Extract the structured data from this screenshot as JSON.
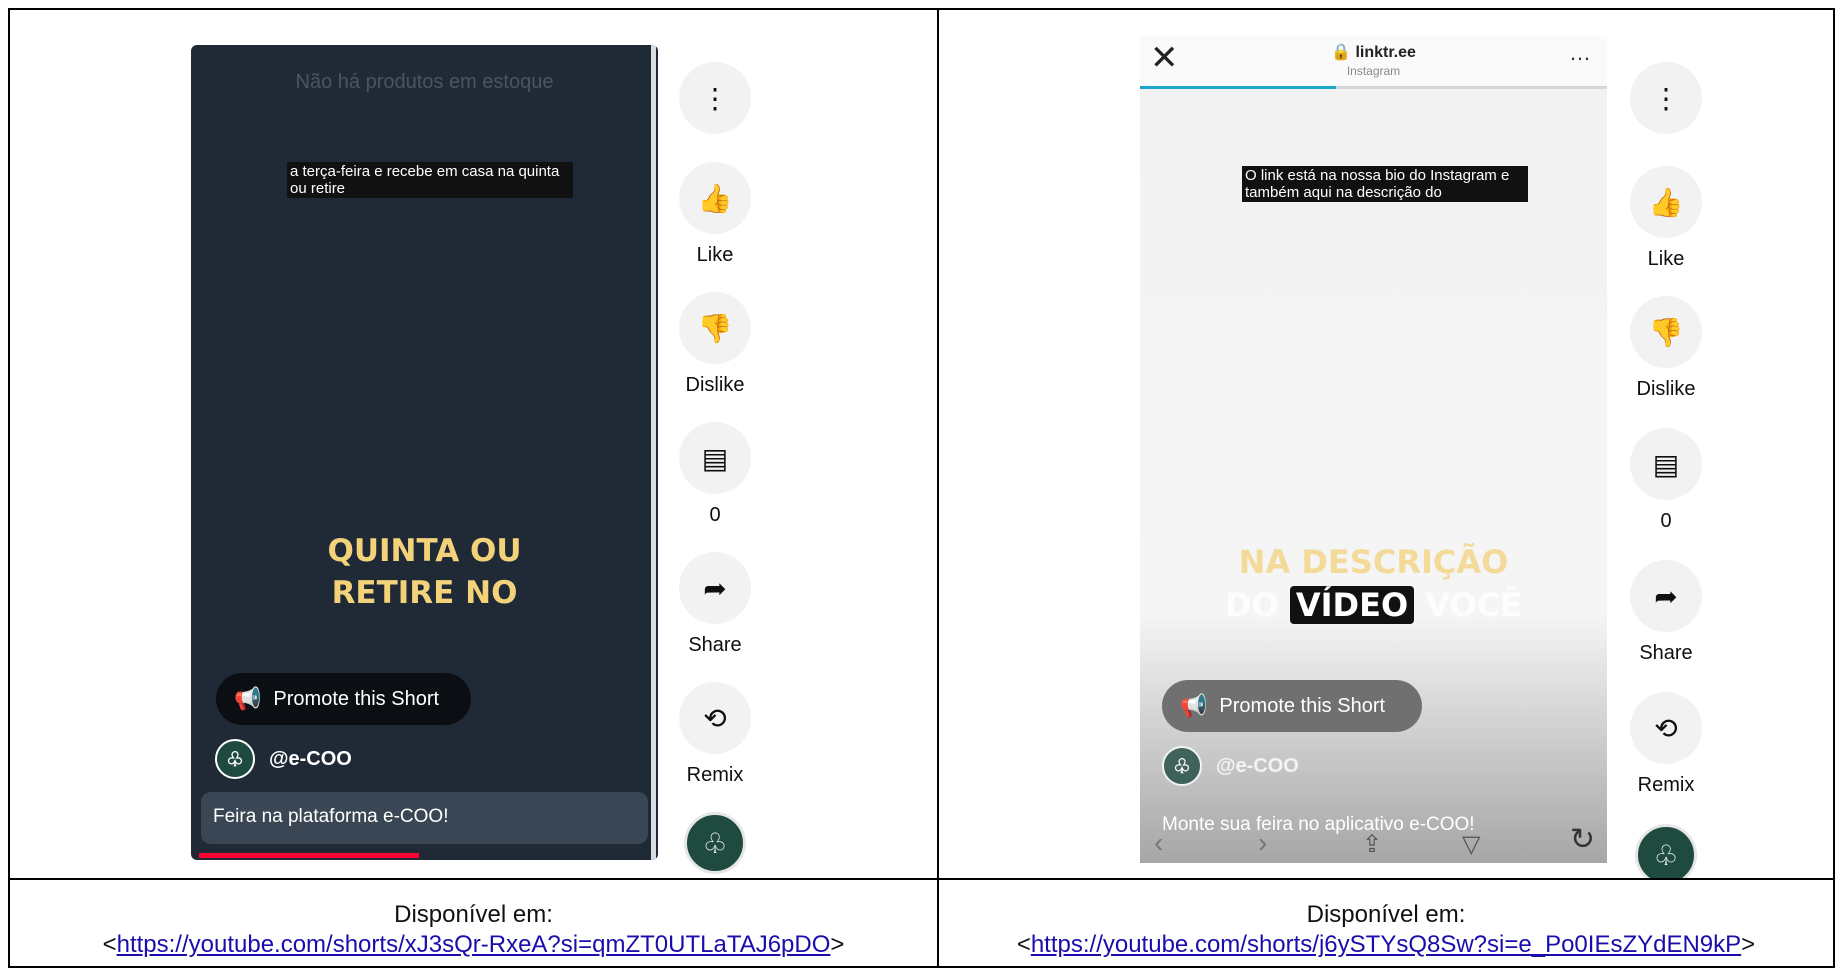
{
  "left": {
    "frame": {
      "top_text": "Não há produtos em estoque",
      "caption": "a terça-feira e recebe em casa na quinta ou retire",
      "big_text_1": "QUINTA OU",
      "big_text_2": "RETIRE NO",
      "promote_label": "Promote this Short",
      "channel": "@e-COO",
      "description": "Feira na plataforma e-COO!"
    },
    "actions": {
      "like_label": "Like",
      "dislike_label": "Dislike",
      "comments_count": "0",
      "share_label": "Share",
      "remix_label": "Remix"
    },
    "caption_label": "Disponível em:",
    "caption_link": "https://youtube.com/shorts/xJ3sQr-RxeA?si=qmZT0UTLaTAJ6pDO",
    "caption_open": "<",
    "caption_close": ">"
  },
  "right": {
    "frame": {
      "browser_title": "linktr.ee",
      "browser_subtitle": "Instagram",
      "caption": "O link está na nossa bio do Instagram e também aqui na descrição do",
      "big_text_1": "NA DESCRIÇÃO",
      "big_text_2a": "DO",
      "big_text_2b": "VÍDEO",
      "big_text_2c": "VOCÊ",
      "promote_label": "Promote this Short",
      "channel": "@e-COO",
      "description": "Monte sua feira no aplicativo e-COO!"
    },
    "actions": {
      "like_label": "Like",
      "dislike_label": "Dislike",
      "comments_count": "0",
      "share_label": "Share",
      "remix_label": "Remix"
    },
    "caption_label": "Disponível em:",
    "caption_link": "https://youtube.com/shorts/j6ySTYsQ8Sw?si=e_Po0IEsZYdEN9kP",
    "caption_open": "<",
    "caption_close": ">"
  },
  "colors": {
    "left_bg": "#1f2a36",
    "yellow_text": "#f3d27a",
    "progress_red": "#ff0033",
    "avatar_green": "#1e4a40"
  },
  "icons": [
    "more-vert-icon",
    "thumb-up-icon",
    "thumb-down-icon",
    "comment-icon",
    "share-icon",
    "remix-icon",
    "megaphone-icon",
    "leaf-logo-icon",
    "close-icon",
    "lock-icon",
    "refresh-icon"
  ]
}
